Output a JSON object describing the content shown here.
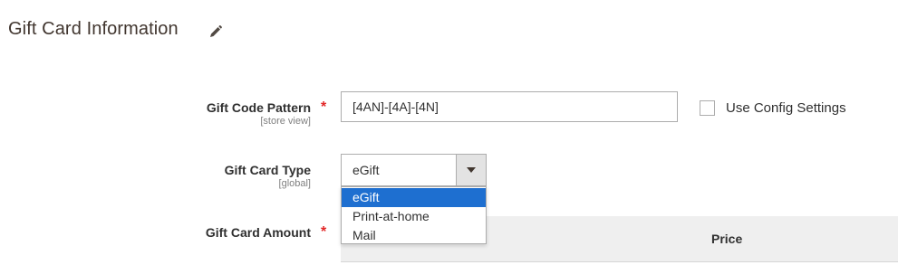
{
  "section": {
    "title": "Gift Card Information",
    "edit_icon": "pencil-icon"
  },
  "fields": {
    "gift_code_pattern": {
      "label": "Gift Code Pattern",
      "scope": "[store view]",
      "required": true,
      "value": "[4AN]-[4A]-[4N]",
      "use_config_label": "Use Config Settings",
      "use_config_checked": false
    },
    "gift_card_type": {
      "label": "Gift Card Type",
      "scope": "[global]",
      "selected": "eGift",
      "options": [
        "eGift",
        "Print-at-home",
        "Mail"
      ],
      "highlighted_option": "eGift"
    },
    "gift_card_amount": {
      "label": "Gift Card Amount",
      "required": true,
      "table_header_price": "Price"
    }
  },
  "colors": {
    "required": "#e22626",
    "highlight": "#1e6fd0",
    "table_header_bg": "#efefef"
  }
}
